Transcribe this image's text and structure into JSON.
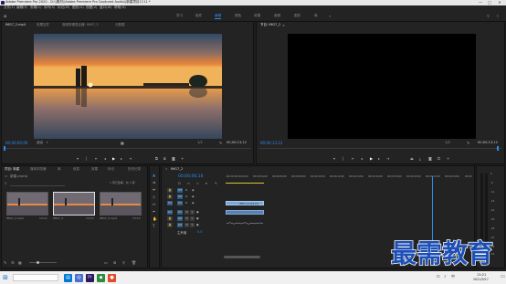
{
  "window": {
    "title": "Adobe Premiere Pro 2020 - D:\\\\素材\\\\Adobe Premiere Pro Captured Audio\\\\新建项目1111 *",
    "controls": [
      "—",
      "□",
      "✕"
    ]
  },
  "menu": [
    "文件(F)",
    "编辑(E)",
    "剪辑(C)",
    "序列(S)",
    "标记(M)",
    "图形(G)",
    "视图(V)",
    "窗口(W)",
    "帮助(H)"
  ],
  "workspaces": [
    "学习",
    "组件",
    "编辑",
    "颜色",
    "效果",
    "音频",
    "图形",
    "库"
  ],
  "workspace_active": "编辑",
  "source_monitor": {
    "tabs": [
      "IMG7_2.mp4",
      "效果控件",
      "音频剪辑混合器: IMG7_2",
      "元数据"
    ],
    "timecode_in": "00;00;00;00",
    "fit": "适合",
    "ratio": "1/2",
    "timecode_out": "00;00;13;12"
  },
  "program_monitor": {
    "tab": "节目: IMG7_2",
    "timecode_in": "00;00;13;12",
    "ratio": "1/2",
    "timecode_out": "00;00;13;12"
  },
  "project": {
    "tabs": [
      "项目: 新建",
      "媒体浏览器",
      "库",
      "信息",
      "效果",
      "标记",
      "历史记录"
    ],
    "filename": "新建.prproj",
    "selection_info": "1 项已选择，共 3 项",
    "items": [
      {
        "name": "IMG7_2.mp4",
        "duration": "13;12"
      },
      {
        "name": "IMG7_2",
        "duration": "13;12"
      },
      {
        "name": "IMG7_2.mp4",
        "duration": "13;12"
      }
    ]
  },
  "timeline": {
    "tab": "IMG7_2",
    "timecode": "00;00;06;16",
    "ruler": [
      ":00;00",
      "00;00;02;00",
      "00;00;04;00",
      "00;00;06;00",
      "00;00;08;00",
      "00;00;10;00",
      "00;00;12;00",
      "00;00;14;00",
      "00;00;16;00",
      "00;00;18;00",
      "00;00;20;00",
      "00;00;22;00",
      "00;00;24;00",
      "00;00"
    ],
    "video_tracks": [
      "V3",
      "V2",
      "V1"
    ],
    "audio_tracks": [
      "A1",
      "A2",
      "A3"
    ],
    "master_label": "主声道",
    "master_value": "0.0",
    "clip_label": "IMG7_2.mp4 [V]",
    "source_label": "V1",
    "source_audio": "A1",
    "meter_scale": [
      "0",
      "-6",
      "-12",
      "-18",
      "-24",
      "-30",
      "-36",
      "-42",
      "-48",
      "-54"
    ]
  },
  "watermark": "最需教育",
  "taskbar": {
    "time": "13:21",
    "date": "2021/9/17",
    "lang": "中"
  },
  "colors": {
    "accent": "#2d8ceb",
    "panel_bg": "#232323",
    "clip": "#7aa9d6",
    "watermark_fill": "#1c4fb5"
  }
}
